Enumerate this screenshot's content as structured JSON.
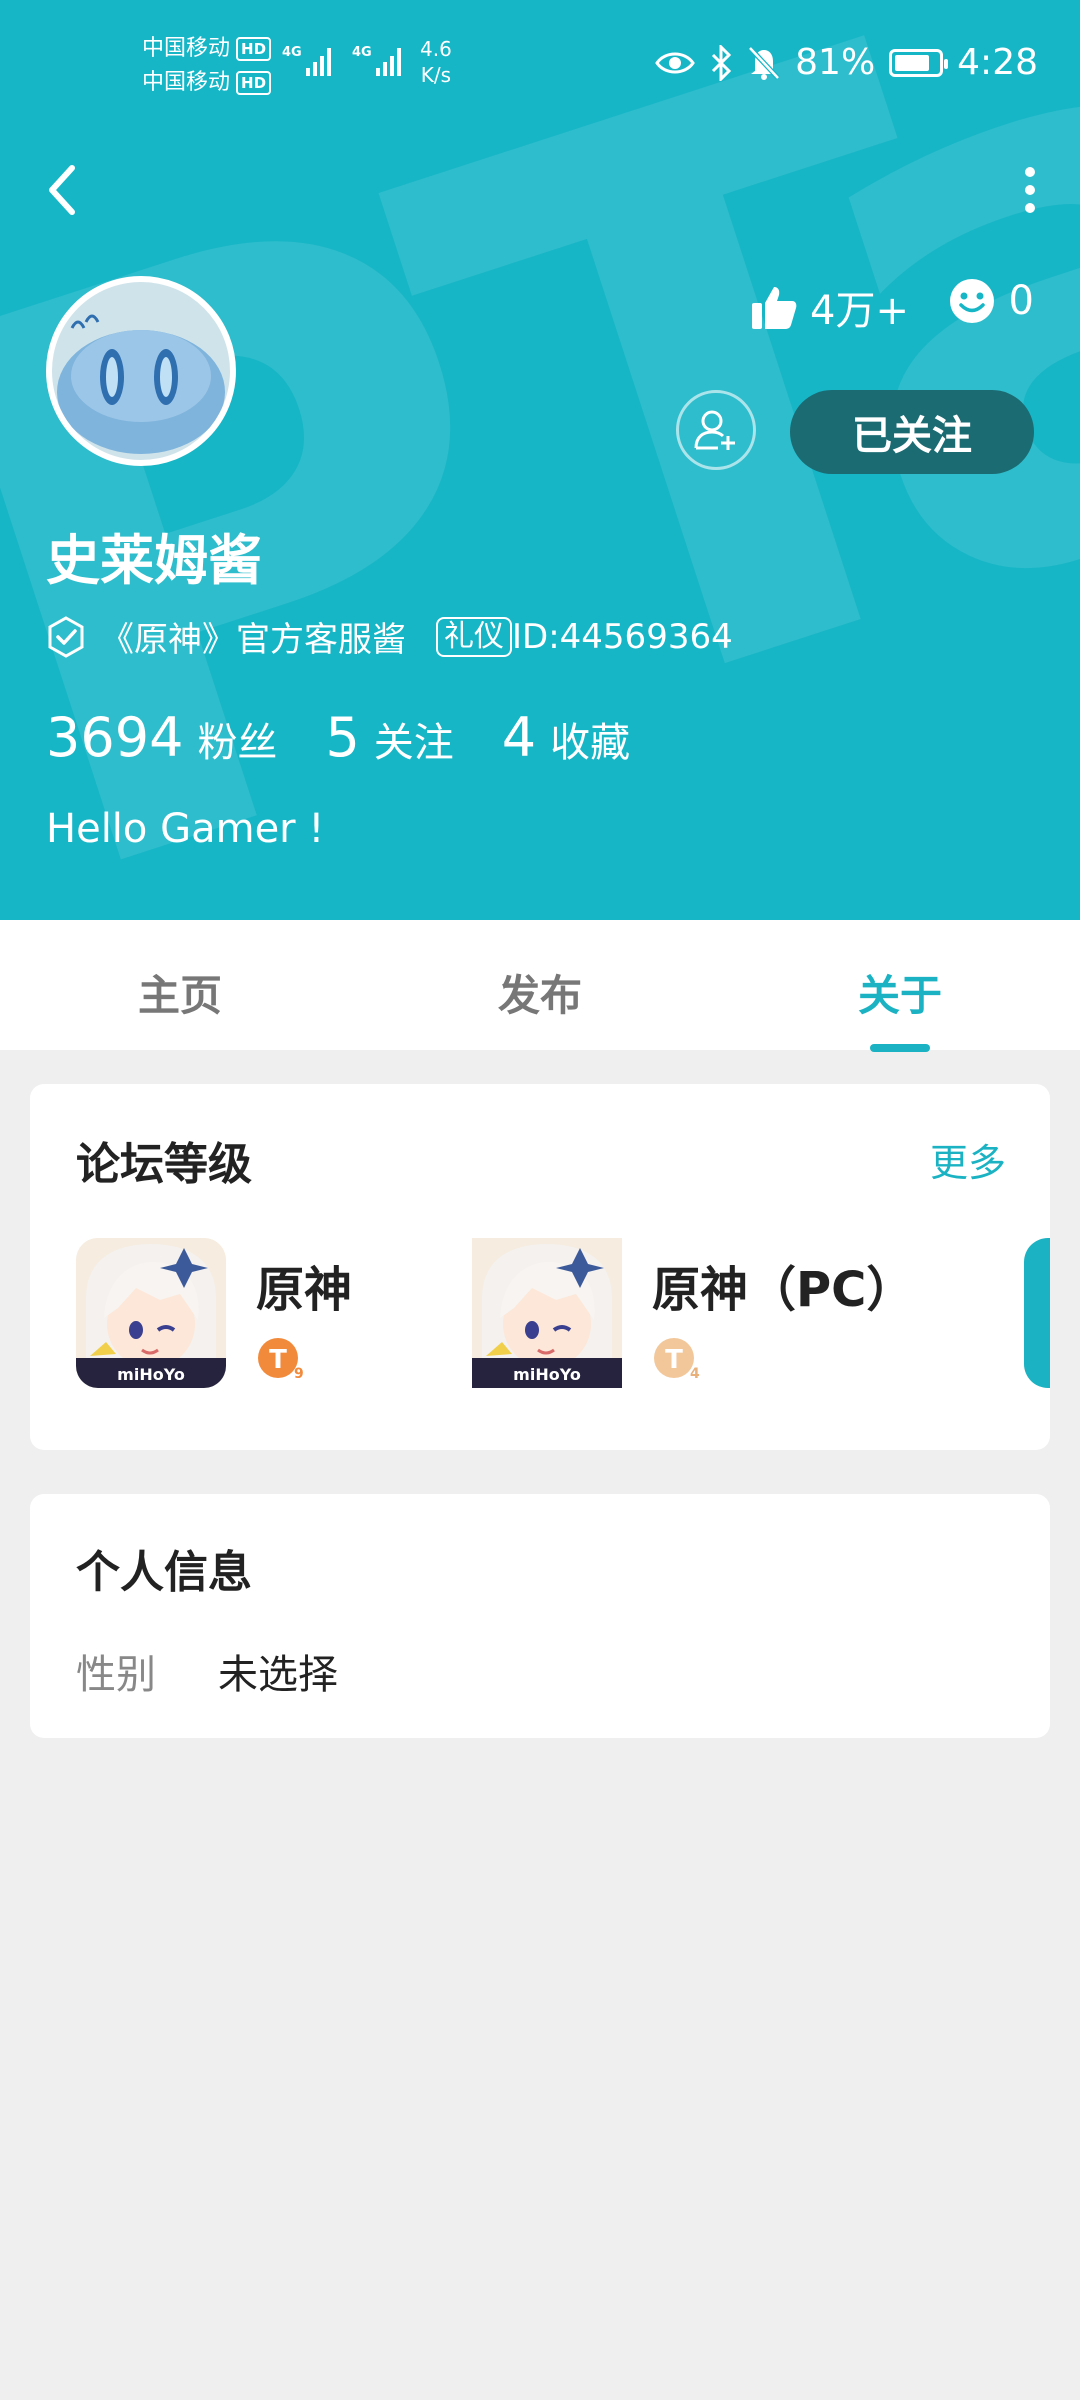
{
  "status_bar": {
    "carrier1": "中国移动",
    "carrier2": "中国移动",
    "hd": "HD",
    "net_type": "4G",
    "speed_value": "4.6",
    "speed_unit": "K/s",
    "battery": "81%",
    "battery_level": 0.81,
    "time": "4:28"
  },
  "profile": {
    "likes": "4万+",
    "smiles": "0",
    "follow_button": "已关注",
    "username": "史莱姆酱",
    "verified_text": "《原神》官方客服酱",
    "tag": "礼仪",
    "id_text": "ID:44569364",
    "counts": [
      {
        "num": "3694",
        "label": "粉丝"
      },
      {
        "num": "5",
        "label": "关注"
      },
      {
        "num": "4",
        "label": "收藏"
      }
    ],
    "bio": "Hello Gamer !"
  },
  "tabs": [
    {
      "label": "主页"
    },
    {
      "label": "发布"
    },
    {
      "label": "关于",
      "active": true
    }
  ],
  "forum_level": {
    "title": "论坛等级",
    "more": "更多",
    "games": [
      {
        "name": "原神",
        "icon_label": "miHoYo",
        "level_letter": "T",
        "level_num": "9"
      },
      {
        "name": "原神（PC）",
        "icon_label": "miHoYo",
        "level_letter": "T",
        "level_num": "4"
      }
    ]
  },
  "personal_info": {
    "title": "个人信息",
    "rows": [
      {
        "key": "性别",
        "value": "未选择"
      }
    ]
  },
  "colors": {
    "header": "#17b6c7",
    "accent": "#1bb3c3",
    "follow_btn": "#1b6b73",
    "background": "#efefef"
  }
}
